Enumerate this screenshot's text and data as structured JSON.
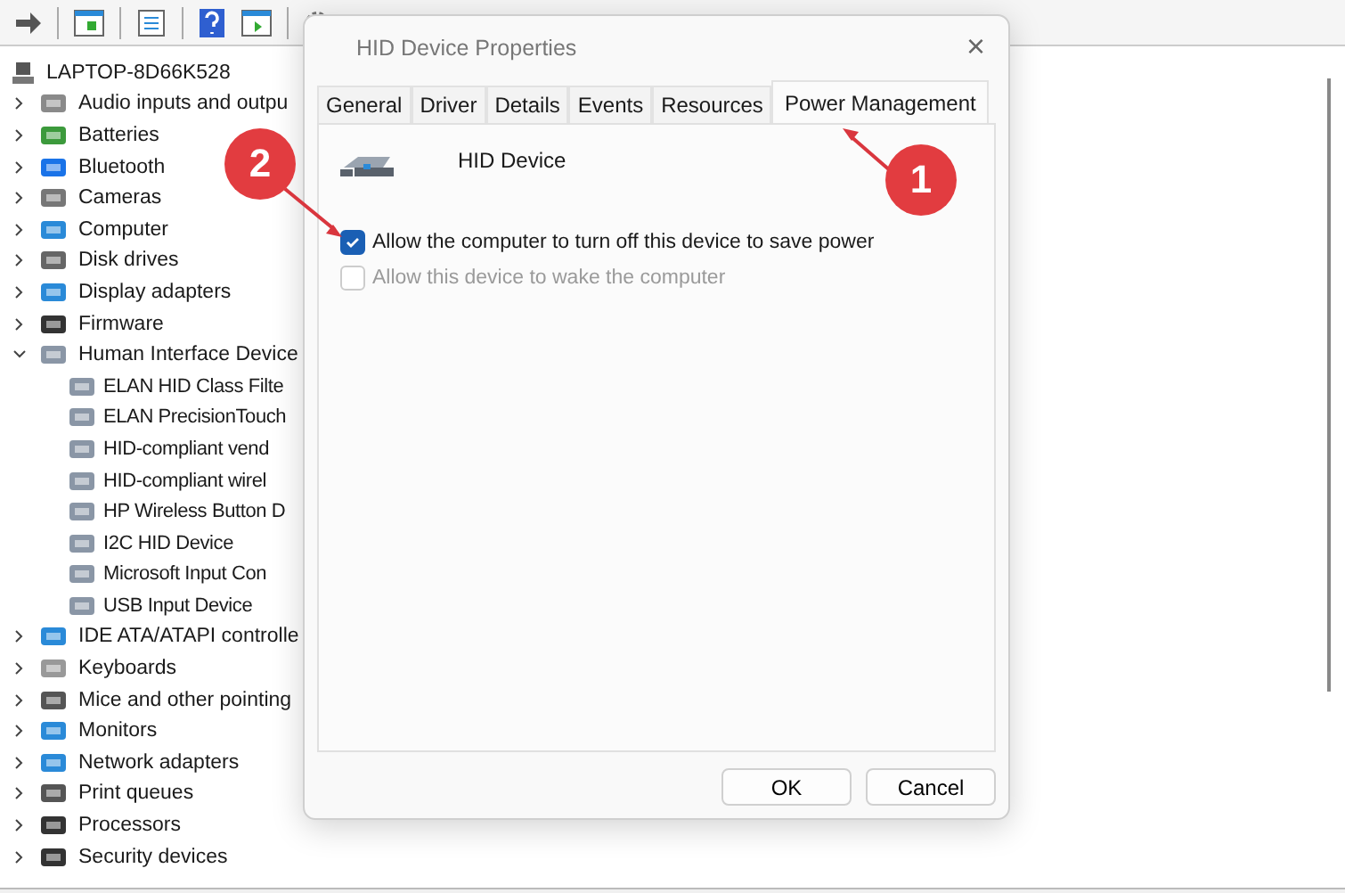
{
  "tree": {
    "root": "LAPTOP-8D66K528",
    "items": [
      {
        "label": "Audio inputs and outpu",
        "kind": "speaker",
        "expanded": false
      },
      {
        "label": "Batteries",
        "kind": "battery",
        "expanded": false
      },
      {
        "label": "Bluetooth",
        "kind": "bluetooth",
        "expanded": false
      },
      {
        "label": "Cameras",
        "kind": "camera",
        "expanded": false
      },
      {
        "label": "Computer",
        "kind": "monitor",
        "expanded": false
      },
      {
        "label": "Disk drives",
        "kind": "disk",
        "expanded": false
      },
      {
        "label": "Display adapters",
        "kind": "card",
        "expanded": false
      },
      {
        "label": "Firmware",
        "kind": "chip",
        "expanded": false
      },
      {
        "label": "Human Interface Device",
        "kind": "hid",
        "expanded": true,
        "children": [
          {
            "label": "ELAN HID Class Filte",
            "kind": "hid"
          },
          {
            "label": "ELAN PrecisionTouch",
            "kind": "hid"
          },
          {
            "label": "HID-compliant vend",
            "kind": "hid"
          },
          {
            "label": "HID-compliant wirel",
            "kind": "hid"
          },
          {
            "label": "HP Wireless Button D",
            "kind": "hid"
          },
          {
            "label": "I2C HID Device",
            "kind": "hid"
          },
          {
            "label": "Microsoft Input Con",
            "kind": "hid"
          },
          {
            "label": "USB Input Device",
            "kind": "hid"
          }
        ]
      },
      {
        "label": "IDE ATA/ATAPI controlle",
        "kind": "card",
        "expanded": false
      },
      {
        "label": "Keyboards",
        "kind": "keyboard",
        "expanded": false
      },
      {
        "label": "Mice and other pointing",
        "kind": "mouse",
        "expanded": false
      },
      {
        "label": "Monitors",
        "kind": "monitor",
        "expanded": false
      },
      {
        "label": "Network adapters",
        "kind": "network",
        "expanded": false
      },
      {
        "label": "Print queues",
        "kind": "printer",
        "expanded": false
      },
      {
        "label": "Processors",
        "kind": "chip",
        "expanded": false
      },
      {
        "label": "Security devices",
        "kind": "chip",
        "expanded": false
      }
    ]
  },
  "dialog": {
    "title": "HID Device Properties",
    "close": "×",
    "tabs": [
      {
        "label": "General",
        "selected": false
      },
      {
        "label": "Driver",
        "selected": false
      },
      {
        "label": "Details",
        "selected": false
      },
      {
        "label": "Events",
        "selected": false
      },
      {
        "label": "Resources",
        "selected": false
      },
      {
        "label": "Power Management",
        "selected": true
      }
    ],
    "device_name": "HID Device",
    "options": [
      {
        "label": "Allow the computer to turn off this device to save power",
        "checked": true,
        "disabled": false
      },
      {
        "label": "Allow this device to wake the computer",
        "checked": false,
        "disabled": true
      }
    ],
    "buttons": [
      "OK",
      "Cancel"
    ]
  },
  "annotations": [
    {
      "number": "1"
    },
    {
      "number": "2"
    }
  ]
}
